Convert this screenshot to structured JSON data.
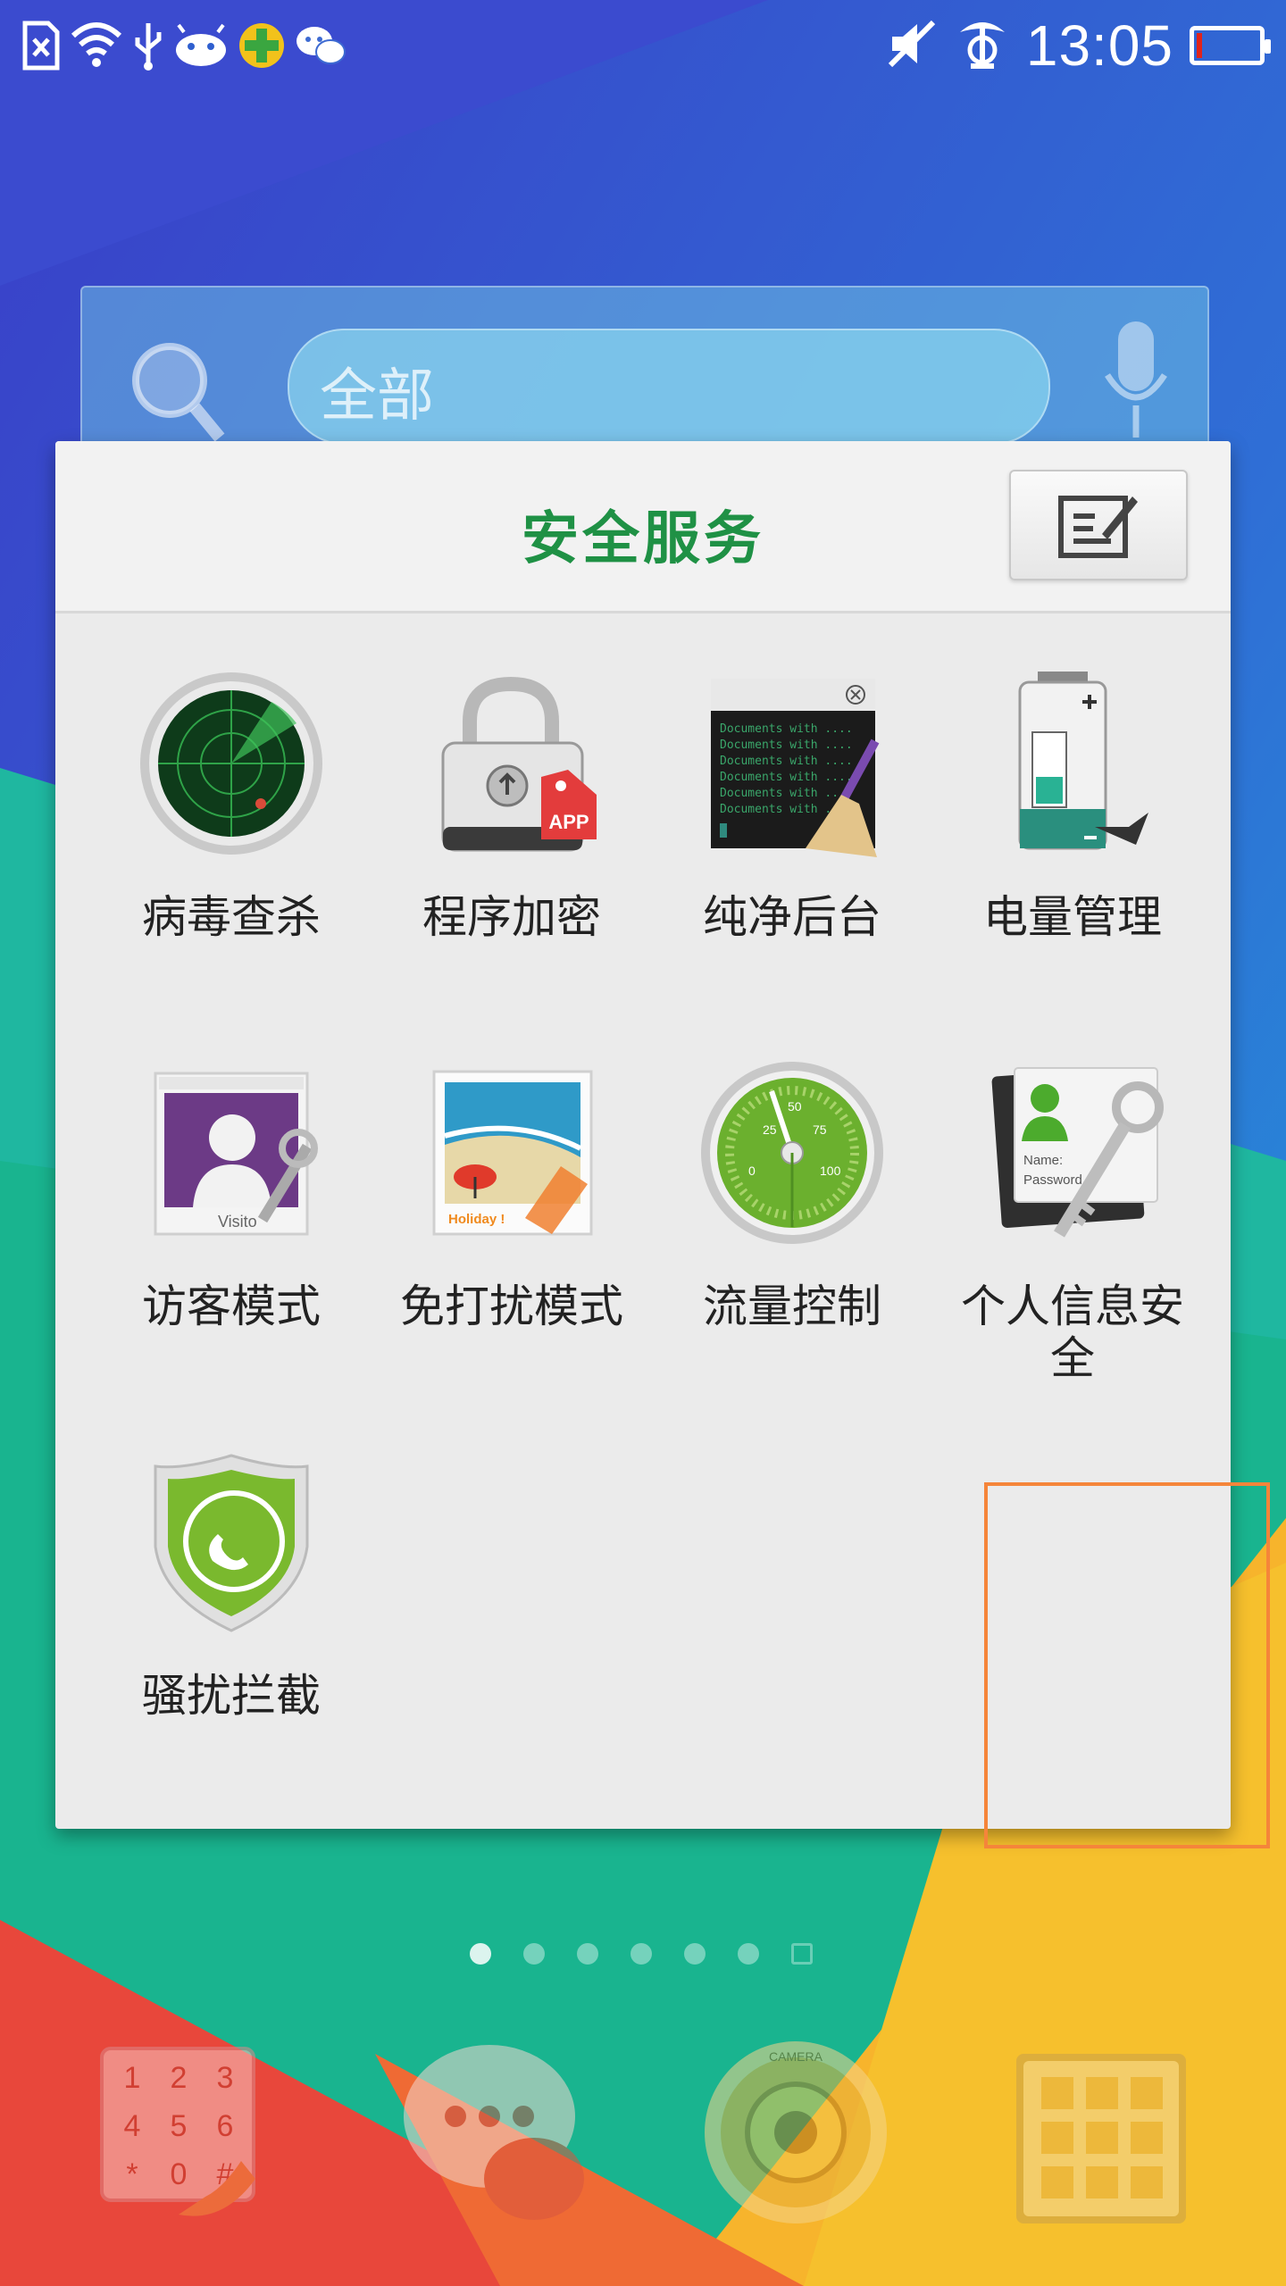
{
  "status_bar": {
    "time": "13:05",
    "icons": [
      "sim-removed-icon",
      "wifi-icon",
      "usb-icon",
      "android-icon",
      "security-app-icon",
      "wechat-icon",
      "mute-icon",
      "alarm-icon",
      "battery-icon"
    ],
    "battery_level": 0.08,
    "battery_color": "#e0231b"
  },
  "search_widget": {
    "placeholder": "全部"
  },
  "folder": {
    "title": "安全服务",
    "title_color": "#1f9145",
    "apps": [
      {
        "label": "病毒查杀",
        "icon": "radar-icon"
      },
      {
        "label": "程序加密",
        "icon": "padlock-icon",
        "badge": "APP"
      },
      {
        "label": "纯净后台",
        "icon": "broom-terminal-icon",
        "lines": [
          "Documents with ....",
          "Documents with ....",
          "Documents with ....",
          "Documents with ....",
          "Documents with ....",
          "Documents with ...."
        ]
      },
      {
        "label": "电量管理",
        "icon": "battery-plug-icon"
      },
      {
        "label": "访客模式",
        "icon": "visitor-icon",
        "caption": "Visito"
      },
      {
        "label": "免打扰模式",
        "icon": "beach-photo-icon",
        "caption": "Holiday !"
      },
      {
        "label": "流量控制",
        "icon": "speedometer-icon",
        "ticks": [
          "25",
          "50",
          "75",
          "0",
          "100"
        ]
      },
      {
        "label": "个人信息安全",
        "icon": "contact-key-icon",
        "fields": [
          "Name:",
          "Password"
        ]
      },
      {
        "label": "骚扰拦截",
        "icon": "shield-phone-icon"
      }
    ],
    "selected_index": 7,
    "highlight_color": "#f5853a"
  },
  "page_dots": {
    "count": 7,
    "active_index": 0
  },
  "dock": {
    "items": [
      {
        "name": "phone",
        "icon": "dialpad-icon",
        "keys": [
          "1",
          "2",
          "3",
          "4",
          "5",
          "6",
          "*",
          "0",
          "#"
        ]
      },
      {
        "name": "messages",
        "icon": "chat-bubbles-icon"
      },
      {
        "name": "camera",
        "icon": "camera-lens-icon",
        "ring_text": "CAMERA"
      },
      {
        "name": "apps",
        "icon": "app-grid-icon"
      }
    ]
  }
}
